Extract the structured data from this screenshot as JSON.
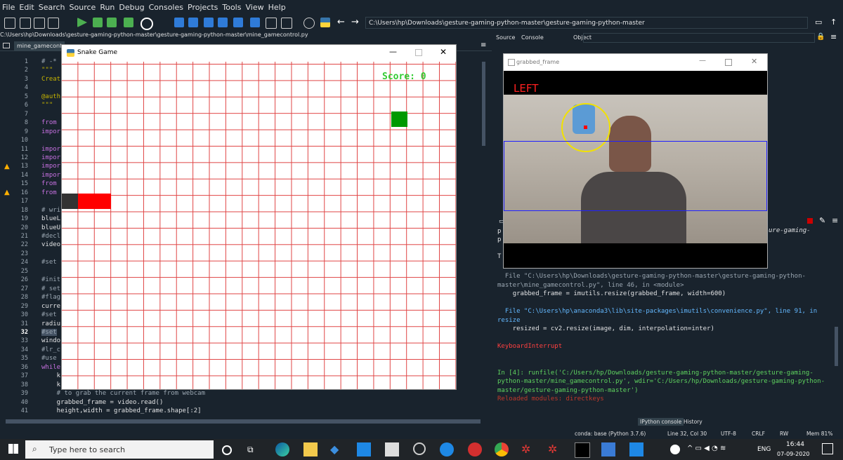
{
  "menu": [
    "File",
    "Edit",
    "Search",
    "Source",
    "Run",
    "Debug",
    "Consoles",
    "Projects",
    "Tools",
    "View",
    "Help"
  ],
  "toolbar": {
    "path": "C:\\Users\\hp\\Downloads\\gesture-gaming-python-master\\gesture-gaming-python-master"
  },
  "editor": {
    "file_path": "C:\\Users\\hp\\Downloads\\gesture-gaming-python-master\\gesture-gaming-python-master\\mine_gamecontrol.py",
    "tab": "mine_gamecontro",
    "lines": [
      {
        "n": "1",
        "t": "# -*"
      },
      {
        "n": "2",
        "t": "\"\"\""
      },
      {
        "n": "3",
        "t": "Creat"
      },
      {
        "n": "4",
        "t": ""
      },
      {
        "n": "5",
        "t": "@auth"
      },
      {
        "n": "6",
        "t": "\"\"\""
      },
      {
        "n": "7",
        "t": ""
      },
      {
        "n": "8",
        "t": "from"
      },
      {
        "n": "9",
        "t": "impor"
      },
      {
        "n": "10",
        "t": ""
      },
      {
        "n": "11",
        "t": "impor"
      },
      {
        "n": "12",
        "t": "impor"
      },
      {
        "n": "13",
        "t": "impor"
      },
      {
        "n": "14",
        "t": "impor"
      },
      {
        "n": "15",
        "t": "from"
      },
      {
        "n": "16",
        "t": "from"
      },
      {
        "n": "17",
        "t": ""
      },
      {
        "n": "18",
        "t": "# wri"
      },
      {
        "n": "19",
        "t": "blueL"
      },
      {
        "n": "20",
        "t": "blueU"
      },
      {
        "n": "21",
        "t": "#decl"
      },
      {
        "n": "22",
        "t": "video"
      },
      {
        "n": "23",
        "t": ""
      },
      {
        "n": "24",
        "t": "#set"
      },
      {
        "n": "25",
        "t": ""
      },
      {
        "n": "26",
        "t": "#init"
      },
      {
        "n": "27",
        "t": "# set"
      },
      {
        "n": "28",
        "t": "#flag"
      },
      {
        "n": "29",
        "t": "curre"
      },
      {
        "n": "30",
        "t": "#set"
      },
      {
        "n": "31",
        "t": "radiu"
      },
      {
        "n": "32",
        "t": "#set"
      },
      {
        "n": "33",
        "t": "windo"
      },
      {
        "n": "34",
        "t": "#lr_c"
      },
      {
        "n": "35",
        "t": "#use"
      },
      {
        "n": "36",
        "t": "while"
      },
      {
        "n": "37",
        "t": "    k"
      },
      {
        "n": "38",
        "t": "    k"
      },
      {
        "n": "39",
        "t": "    # to grab the current frame from webcam"
      },
      {
        "n": "40",
        "t": "    grabbed_frame = video.read()"
      },
      {
        "n": "41",
        "t": "    height,width = grabbed_frame.shape[:2]"
      }
    ]
  },
  "snake_game": {
    "title": "Snake Game",
    "score": "Score: 0"
  },
  "right_pane": {
    "tabs": [
      "Source",
      "Console",
      "Object"
    ],
    "webcam_title": "grabbed_frame",
    "direction_label": "LEFT",
    "console_lines": [
      {
        "t": "  File \"C:\\Users\\hp\\Downloads\\gesture-gaming-python-master\\gesture-gaming-python-master\\mine_gamecontrol.py\", line 46, in <module>",
        "c": "#9aa6b1"
      },
      {
        "t": "    grabbed_frame = imutils.resize(grabbed_frame, width=600)",
        "c": "#e0e1e3"
      },
      {
        "t": "",
        "c": "#e0e1e3"
      },
      {
        "t": "  File \"C:\\Users\\hp\\anaconda3\\lib\\site-packages\\imutils\\convenience.py\", line 91, in resize",
        "c": "#63b8ff"
      },
      {
        "t": "    resized = cv2.resize(image, dim, interpolation=inter)",
        "c": "#e0e1e3"
      },
      {
        "t": "",
        "c": "#e0e1e3"
      },
      {
        "t": "KeyboardInterrupt",
        "c": "#ff4040"
      },
      {
        "t": "",
        "c": "#e0e1e3"
      },
      {
        "t": "",
        "c": "#e0e1e3"
      },
      {
        "t": "In [4]: runfile('C:/Users/hp/Downloads/gesture-gaming-python-master/gesture-gaming-python-master/mine_gamecontrol.py', wdir='C:/Users/hp/Downloads/gesture-gaming-python-master/gesture-gaming-python-master')",
        "c": "#5fd35f"
      },
      {
        "t": "Reloaded modules: directkeys",
        "c": "#c0392b"
      }
    ],
    "console_tabs": [
      "IPython console",
      "History"
    ]
  },
  "statusbar": {
    "conda": "conda: base (Python 3.7.6)",
    "pos": "Line 32, Col 30",
    "encoding": "UTF-8",
    "eol": "CRLF",
    "rw": "RW",
    "mem": "Mem 81%"
  },
  "taskbar": {
    "search_placeholder": "Type here to search",
    "time": "16:44",
    "date": "07-09-2020",
    "lang": "ENG"
  }
}
